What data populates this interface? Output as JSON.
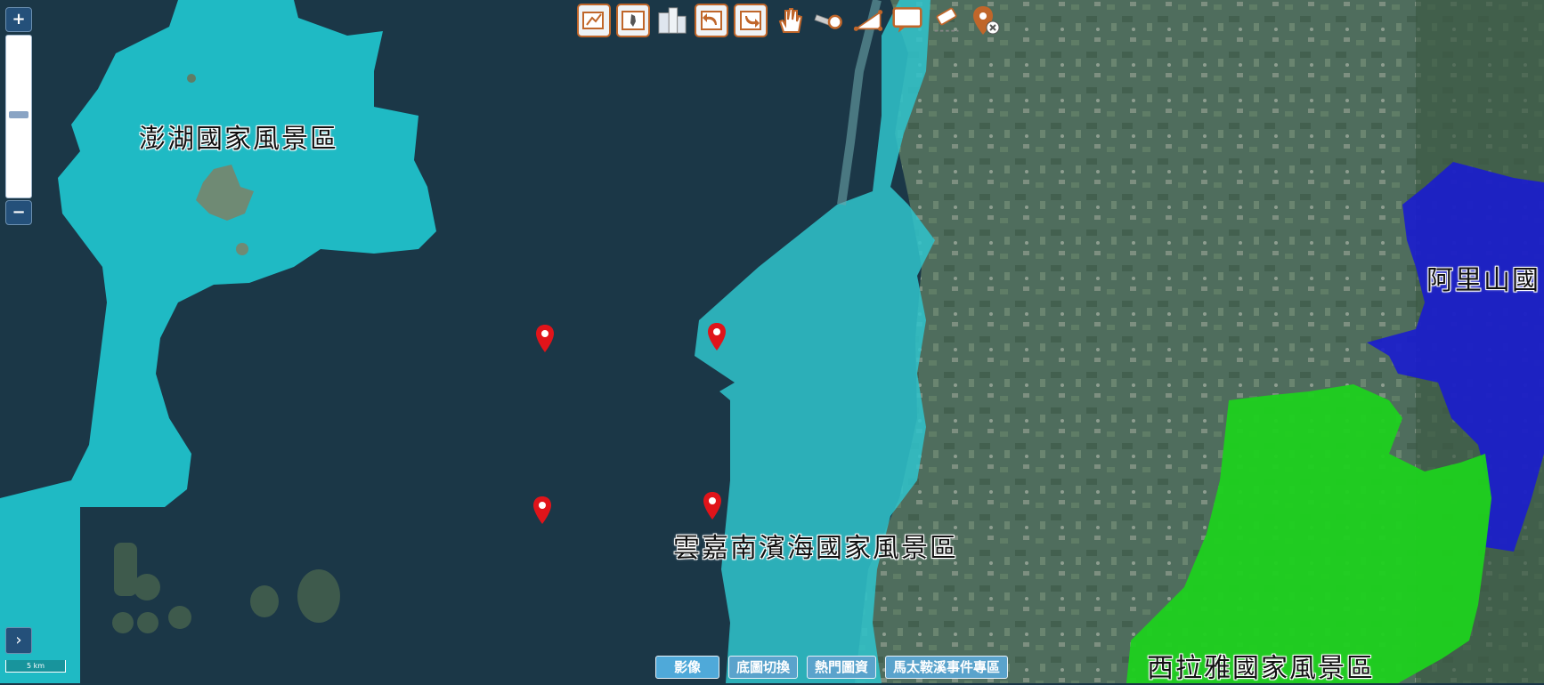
{
  "map": {
    "regions": [
      {
        "name": "澎湖國家風景區",
        "color": "#1fc6cf"
      },
      {
        "name": "雲嘉南濱海國家風景區",
        "color": "#2fc4cc"
      },
      {
        "name": "阿里山國",
        "color": "#1a1ccf"
      },
      {
        "name": "西拉雅國家風景區",
        "color": "#1dd11d"
      }
    ]
  },
  "toolbar": {
    "tools": [
      {
        "icon": "draw-icon"
      },
      {
        "icon": "full-extent-icon"
      },
      {
        "icon": "buildings-icon"
      },
      {
        "icon": "undo-view-icon"
      },
      {
        "icon": "redo-view-icon"
      },
      {
        "icon": "pan-hand-icon"
      },
      {
        "icon": "measure-distance-icon"
      },
      {
        "icon": "measure-area-icon"
      },
      {
        "icon": "annotation-icon"
      },
      {
        "icon": "eraser-icon"
      },
      {
        "icon": "clear-markers-icon"
      }
    ]
  },
  "zoom": {
    "plus": "+",
    "minus": "−",
    "level_fraction": 0.48
  },
  "bottom_buttons": [
    {
      "label": "影像",
      "active": true
    },
    {
      "label": "底圖切換",
      "active": false
    },
    {
      "label": "熱門圖資",
      "active": false
    },
    {
      "label": "馬太鞍溪事件專區",
      "active": false
    }
  ],
  "expander": "›",
  "scale": "5 km",
  "colors": {
    "sea": "#1b3747",
    "land": "#4d6b5c",
    "accent": "#c0662a",
    "marker": "#e0141a"
  }
}
